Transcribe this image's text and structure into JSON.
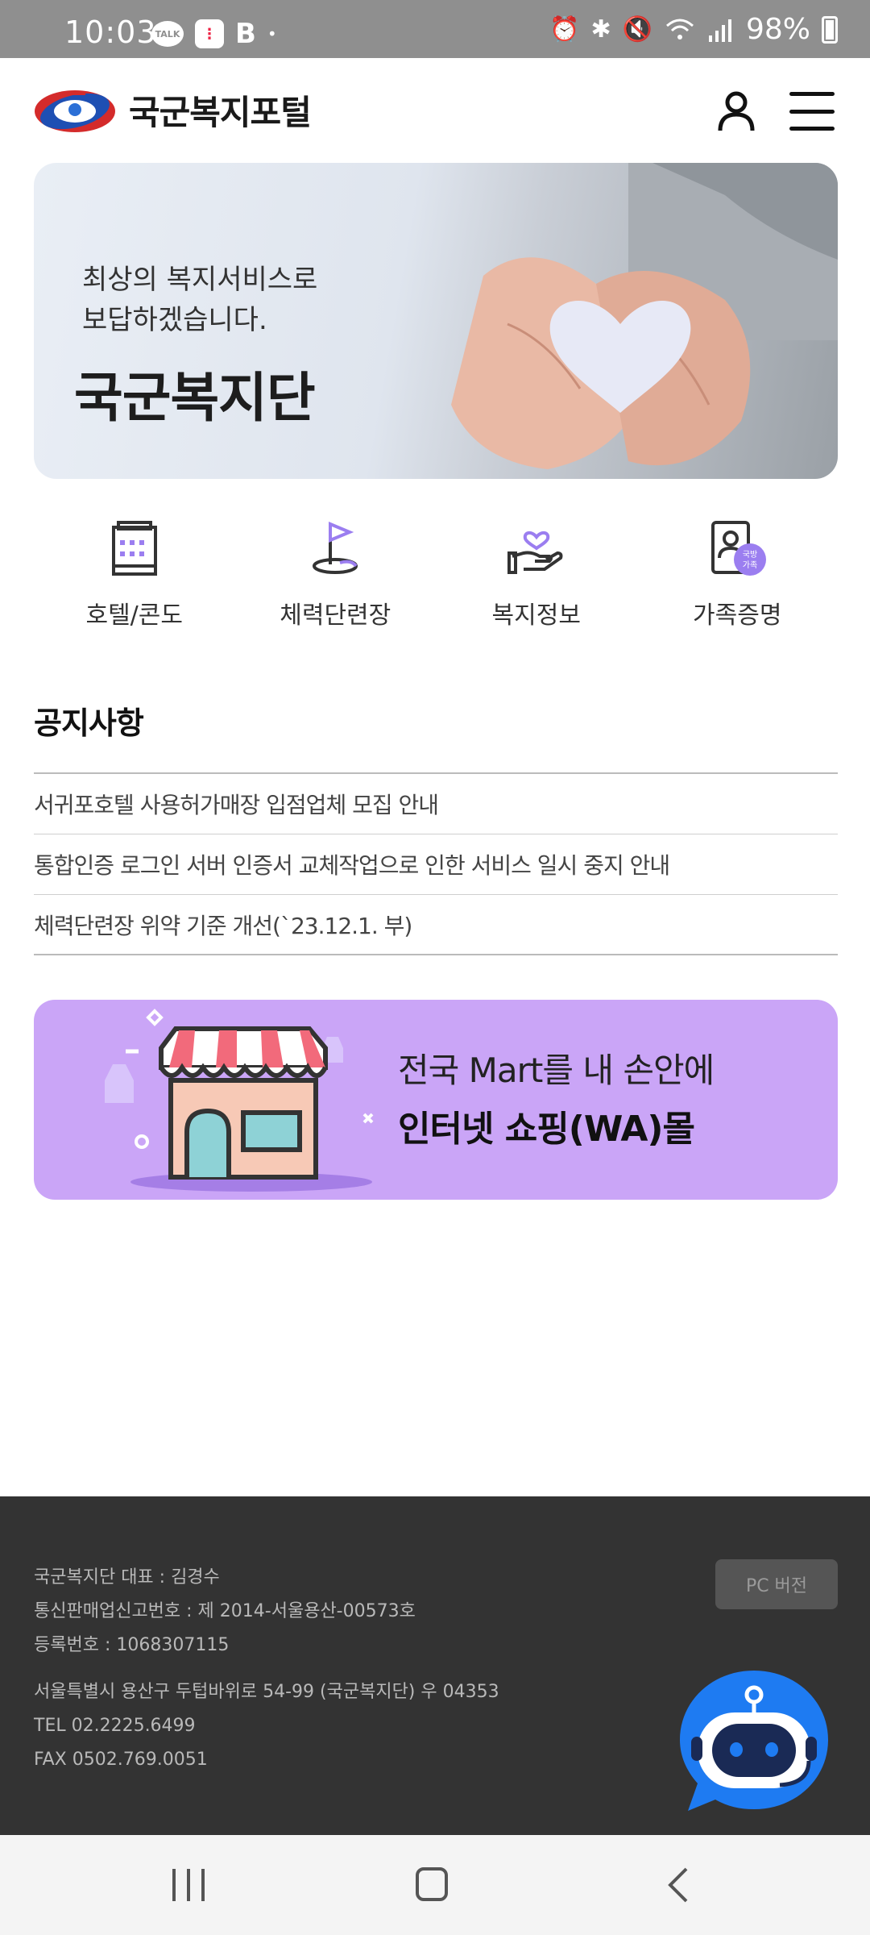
{
  "status_bar": {
    "time": "10:03",
    "battery": "98%",
    "left_icons": [
      "kakaotalk-icon",
      "app-notification-icon",
      "b-app-icon",
      "dot-icon"
    ],
    "talk_label": "TALK",
    "b_label": "B",
    "dot": "•",
    "right_icons": [
      "alarm-icon",
      "bluetooth-icon",
      "mute-icon",
      "wifi-icon",
      "signal-icon",
      "battery-icon"
    ]
  },
  "header": {
    "logo_text": "국군복지포털",
    "user_icon": "user-icon",
    "menu_icon": "hamburger-menu-icon"
  },
  "hero": {
    "subtitle": "최상의 복지서비스로\n보답하겠습니다.",
    "title": "국군복지단"
  },
  "quick_menu": [
    {
      "label": "호텔/콘도",
      "icon": "hotel-icon"
    },
    {
      "label": "체력단련장",
      "icon": "golf-flag-icon"
    },
    {
      "label": "복지정보",
      "icon": "heart-hand-icon"
    },
    {
      "label": "가족증명",
      "icon": "family-id-icon",
      "badge": "국방\n가족"
    }
  ],
  "notices": {
    "title": "공지사항",
    "items": [
      "서귀포호텔 사용허가매장 입점업체 모집 안내",
      "통합인증 로그인 서버 인증서 교체작업으로 인한 서비스 일시 중지 안내",
      "체력단련장 위약 기준 개선(`23.12.1. 부)"
    ]
  },
  "mall_banner": {
    "line1": "전국 Mart를 내 손안에",
    "line2": "인터넷 쇼핑(WA)몰"
  },
  "footer": {
    "ceo": "국군복지단 대표 : 김경수",
    "business_reg": "통신판매업신고번호 : 제 2014-서울용산-00573호",
    "reg_no": "등록번호 : 1068307115",
    "address": "서울특별시 용산구 두텁바위로 54-99 (국군복지단) 우 04353",
    "tel": "TEL 02.2225.6499",
    "fax": "FAX 0502.769.0051",
    "pc_button": "PC 버전",
    "chatbot_icon": "chatbot-icon"
  },
  "nav_bar": [
    "recent-apps-icon",
    "home-icon",
    "back-icon"
  ],
  "colors": {
    "status_bar": "#8f8f8f",
    "footer": "#333333",
    "mall_banner": "#caa5f7",
    "accent_purple": "#9b7ef0",
    "chatbot_blue": "#1e7bf2"
  }
}
